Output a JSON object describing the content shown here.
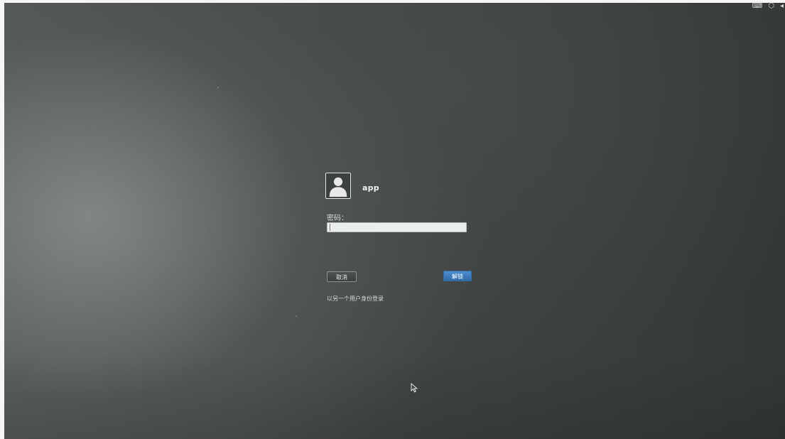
{
  "tray": {
    "icons": [
      "keyboard-icon",
      "network-icon",
      "volume-icon"
    ],
    "glyphs": [
      "⌨",
      "⬡",
      "◂"
    ]
  },
  "login": {
    "username": "app",
    "password_label": "密码：",
    "password_value": "",
    "cancel_label": "取消",
    "unlock_label": "解锁",
    "other_user_label": "以另一个用户身份登录",
    "avatar_icon": "user-avatar-icon"
  },
  "colors": {
    "unlock_button": "#3a7abf",
    "background": "#454948",
    "text": "#f2f2f2"
  }
}
